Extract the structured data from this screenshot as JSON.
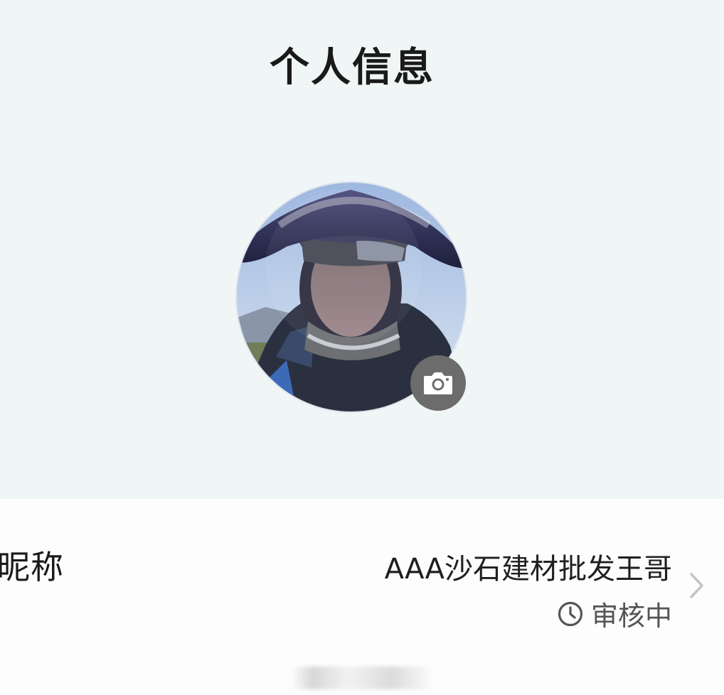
{
  "header": {
    "title": "个人信息"
  },
  "avatar": {
    "camera_icon": "camera-icon"
  },
  "profile": {
    "nickname_label": "昵称",
    "nickname_value": "AAA沙石建材批发王哥",
    "status_icon": "clock-icon",
    "status_text": "审核中",
    "chevron_icon": "chevron-right-icon"
  },
  "colors": {
    "top_background": "#f0f5f6",
    "card_background": "#fdfdfd",
    "camera_badge": "#6c6c6c",
    "text_primary": "#1a1a1a",
    "text_secondary": "#555555",
    "chevron": "#c4c4c4"
  }
}
